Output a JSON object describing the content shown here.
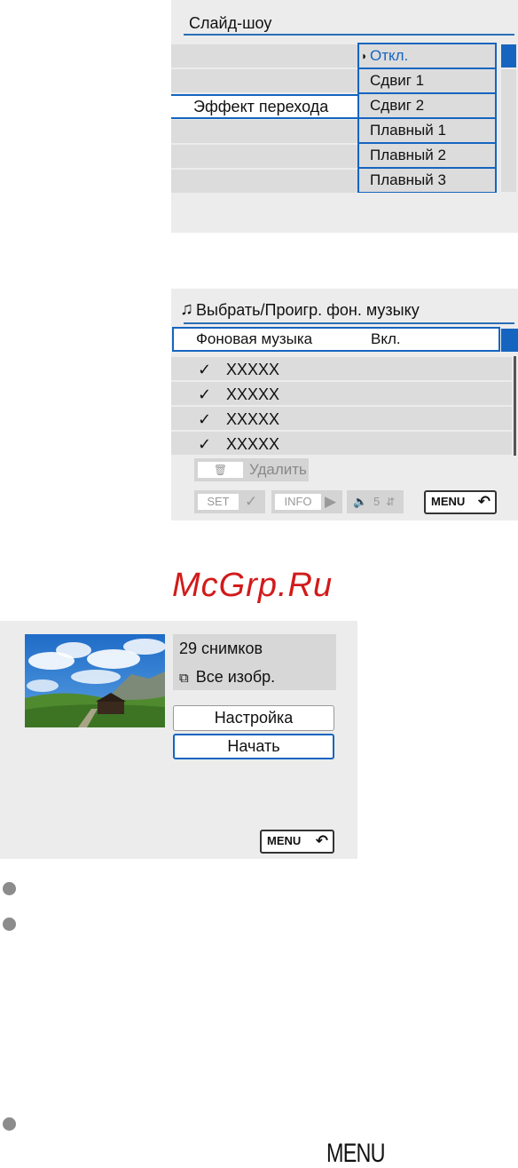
{
  "slideshow_screen": {
    "title": "Слайд-шоу",
    "selected_setting_label": "Эффект перехода",
    "options": [
      "Откл.",
      "Сдвиг 1",
      "Сдвиг 2",
      "Плавный 1",
      "Плавный 2",
      "Плавный 3"
    ],
    "current_option": "Откл.",
    "accent_color": "#1565c0"
  },
  "music_screen": {
    "title": "Выбрать/Проигр. фон. музыку",
    "note_icon": "music-note-icon",
    "bg_music_label": "Фоновая музыка",
    "bg_music_value": "Вкл.",
    "tracks": [
      {
        "checked": true,
        "name": "XXXXX"
      },
      {
        "checked": true,
        "name": "XXXXX"
      },
      {
        "checked": true,
        "name": "XXXXX"
      },
      {
        "checked": true,
        "name": "XXXXX"
      }
    ],
    "delete_label": "Удалить",
    "guide": {
      "set_key": "SET",
      "info_key": "INFO",
      "volume_value": "5",
      "menu_key": "MENU"
    }
  },
  "watermark": "McGrp.Ru",
  "start_screen": {
    "image_count": "29 снимков",
    "filter_label": "Все изобр.",
    "setup_button": "Настройка",
    "start_button": "Начать",
    "menu_key": "MENU"
  },
  "footer": {
    "menu_text": "MENU"
  }
}
